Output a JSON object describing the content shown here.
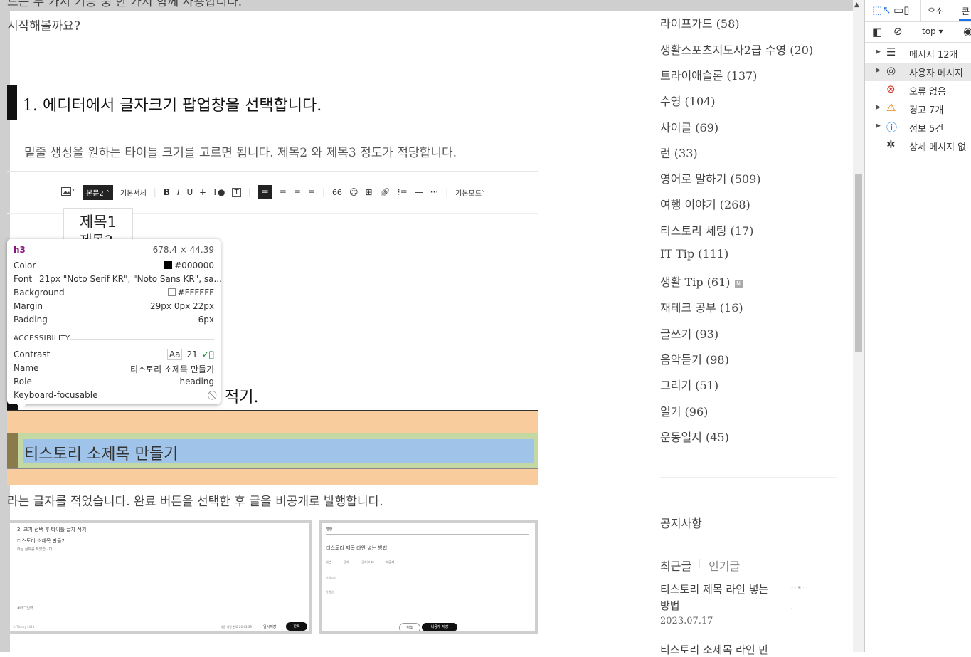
{
  "article": {
    "intro_partial": "드는 두 가지 기능 중 한 가지 함께 사용합니다.",
    "intro_start": "시작해볼까요?",
    "step1_heading": "1.  에디터에서 글자크기 팝업창을 선택합니다.",
    "step1_desc": "밑줄 생성을 원하는 타이틀 크기를 고르면 됩니다. 제목2 와 제목3 정도가 적당합니다.",
    "step2_heading_tail": "적기.",
    "highlighted_heading": "티스토리 소제목 만들기",
    "step2_desc": "라는 글자를 적었습니다.  완료 버튼을 선택한 후 글을 비공개로 발행합니다."
  },
  "editor": {
    "image_icon": "image-icon",
    "style_select": "본문2",
    "font_select": "기본서체",
    "bold": "B",
    "italic": "I",
    "underline": "U",
    "strike": "T",
    "text_color": "T",
    "text_bg": "T",
    "quote": "66",
    "emoji": "☺",
    "more": "···",
    "mode_select": "기본모드",
    "dropdown_items": [
      "제목1",
      "제목2"
    ]
  },
  "thumb1": {
    "line1": "2. 크기 선택 후 타이틀 글자 적기.",
    "line2": "티스토리 소제목 만들기",
    "line3": "라는 글자를 적었습니다.",
    "tag": "#태그입력",
    "footer_left": "© Tistory 2023",
    "footer_right": "자동 저장 완료 20:43:39",
    "save_label": "임시저장",
    "done_label": "완료"
  },
  "thumb2": {
    "header": "발행",
    "title": "티스토리 제목 라인 넣는 방법",
    "visibility_label": "기본",
    "visibility_options": [
      "공개",
      "공개(보호)",
      "비공개"
    ],
    "category_label": "카테고리",
    "url_label": "발행일",
    "cancel_label": "취소",
    "publish_label": "비공개 저장"
  },
  "tooltip": {
    "tag": "h3",
    "size": "678.4 × 44.39",
    "color_label": "Color",
    "color_value": "#000000",
    "font_label": "Font",
    "font_value": "21px \"Noto Serif KR\", \"Noto Sans KR\", sa...",
    "background_label": "Background",
    "background_value": "#FFFFFF",
    "margin_label": "Margin",
    "margin_value": "29px 0px 22px",
    "padding_label": "Padding",
    "padding_value": "6px",
    "accessibility_label": "ACCESSIBILITY",
    "contrast_label": "Contrast",
    "contrast_aa": "Aa",
    "contrast_value": "21",
    "name_label": "Name",
    "name_value": "티스토리 소제목 만들기",
    "role_label": "Role",
    "role_value": "heading",
    "focus_label": "Keyboard-focusable"
  },
  "sidebar": {
    "categories": [
      "라이프가드 (58)",
      "생활스포츠지도사2급 수영 (20)",
      "트라이애슬론 (137)",
      "수영 (104)",
      "사이클 (69)",
      "런 (33)",
      "영어로 말하기 (509)",
      "여행 이야기 (268)",
      "티스토리 세팅 (17)",
      "IT Tip (111)",
      "생활 Tip (61)",
      "재테크 공부 (16)",
      "글쓰기 (93)",
      "음악듣기 (98)",
      "그리기 (51)",
      "일기 (96)",
      "운동일지 (45)"
    ],
    "new_badge": "N",
    "notice": "공지사항",
    "tab_recent": "최근글",
    "tab_popular": "인기글",
    "post1_title": "티스토리 제목 라인 넣는 방법",
    "post1_date": "2023.07.17",
    "post2_title": "티스토리 소제목 라인 만"
  },
  "devtools": {
    "tab_elements": "요소",
    "tab_console": "콘",
    "context": "top",
    "rows": [
      {
        "label": "메시지 12개",
        "icon": "list-icon"
      },
      {
        "label": "사용자 메시지",
        "icon": "user-icon"
      },
      {
        "label": "오류 없음",
        "icon": "error-icon"
      },
      {
        "label": "경고 7개",
        "icon": "warning-icon"
      },
      {
        "label": "정보 5건",
        "icon": "info-icon"
      },
      {
        "label": "상세 메시지 없",
        "icon": "bug-icon"
      }
    ]
  },
  "colors": {
    "margin_highlight": "#f9cc9d",
    "padding_highlight": "#c3d8a3",
    "content_highlight": "#9fc3e9",
    "devtools_blue": "#1a73e8"
  }
}
